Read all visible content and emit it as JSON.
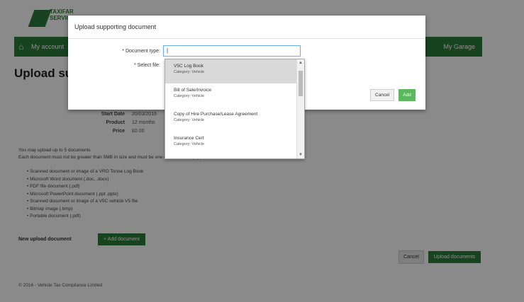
{
  "app": {
    "logo_text": [
      "TAXIFAR",
      "SERVICES"
    ],
    "nav_home": "⌂",
    "nav_text": "My account",
    "nav_user": "My Garage"
  },
  "page": {
    "title": "Upload su",
    "info": [
      {
        "label": "Start Date",
        "value": "20/03/2016"
      },
      {
        "label": "Product",
        "value": "12 months"
      },
      {
        "label": "Price",
        "value": "£0.00"
      }
    ],
    "notice_line1": "You may upload up to 5 documents",
    "notice_line2": "Each document must not be greater than 5MB in size and must be one of the following types:",
    "bullets": [
      "Scanned document or image of a VRO Tonne Log Book",
      "Microsoft Word document (.doc, .docx)",
      "PDF file document (.pdf)",
      "Microsoft PowerPoint document (.ppt .pptx)",
      "Scanned document or image of a V5C vehicle V5 file",
      "Bitmap image (.bmp)",
      "Portable document (.pdf)"
    ],
    "add_label": "New upload document",
    "add_button": "Add document",
    "cancel_button": "Cancel",
    "continue_button": "Upload documents",
    "footer": "© 2016 - Vehicle Tax Compliance Limited"
  },
  "modal": {
    "title": "Upload supporting document",
    "doc_type_label": "* Document type:",
    "select_file_label": "* Select file:",
    "select_value": "|",
    "cancel": "Cancel",
    "add": "Add",
    "options": [
      {
        "name": "V5C Log Book",
        "category": "Category: Vehicle",
        "selected": true
      },
      {
        "name": "Bill of Sale/Invoice",
        "category": "Category: Vehicle",
        "selected": false
      },
      {
        "name": "Copy of Hire Purchase/Lease Agreement",
        "category": "Category: Vehicle",
        "selected": false
      },
      {
        "name": "Insurance Cert",
        "category": "Category: Vehicle",
        "selected": false
      }
    ]
  },
  "colors": {
    "brand_green": "#2c7a3a",
    "add_green": "#5cb85c"
  }
}
